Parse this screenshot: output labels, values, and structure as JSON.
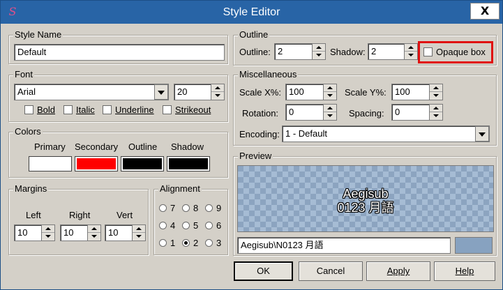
{
  "window": {
    "title": "Style Editor",
    "app_icon_glyph": "S",
    "close_glyph": "X"
  },
  "style_name": {
    "label": "Style Name",
    "value": "Default"
  },
  "font": {
    "label": "Font",
    "face": "Arial",
    "size": "20",
    "bold": "Bold",
    "italic": "Italic",
    "underline": "Underline",
    "strikeout": "Strikeout"
  },
  "colors": {
    "label": "Colors",
    "primary": {
      "label": "Primary",
      "hex": "#ffffff"
    },
    "secondary": {
      "label": "Secondary",
      "hex": "#ff0000"
    },
    "outline": {
      "label": "Outline",
      "hex": "#000000"
    },
    "shadow": {
      "label": "Shadow",
      "hex": "#000000"
    }
  },
  "margins": {
    "label": "Margins",
    "left_label": "Left",
    "right_label": "Right",
    "vert_label": "Vert",
    "left": "10",
    "right": "10",
    "vert": "10"
  },
  "alignment": {
    "label": "Alignment",
    "options": [
      "7",
      "8",
      "9",
      "4",
      "5",
      "6",
      "1",
      "2",
      "3"
    ],
    "selected": "2"
  },
  "outline": {
    "label": "Outline",
    "outline_label": "Outline:",
    "outline_value": "2",
    "shadow_label": "Shadow:",
    "shadow_value": "2",
    "opaque_box": "Opaque box"
  },
  "misc": {
    "label": "Miscellaneous",
    "scale_x_label": "Scale X%:",
    "scale_x": "100",
    "scale_y_label": "Scale Y%:",
    "scale_y": "100",
    "rotation_label": "Rotation:",
    "rotation": "0",
    "spacing_label": "Spacing:",
    "spacing": "0",
    "encoding_label": "Encoding:",
    "encoding": "1 - Default"
  },
  "preview": {
    "label": "Preview",
    "line1": "Aegisub",
    "line2": "0123 月語",
    "text_value": "Aegisub\\N0123 月語",
    "bg_color": "#87a2c0"
  },
  "buttons": {
    "ok": "OK",
    "cancel": "Cancel",
    "apply": "Apply",
    "help": "Help"
  }
}
